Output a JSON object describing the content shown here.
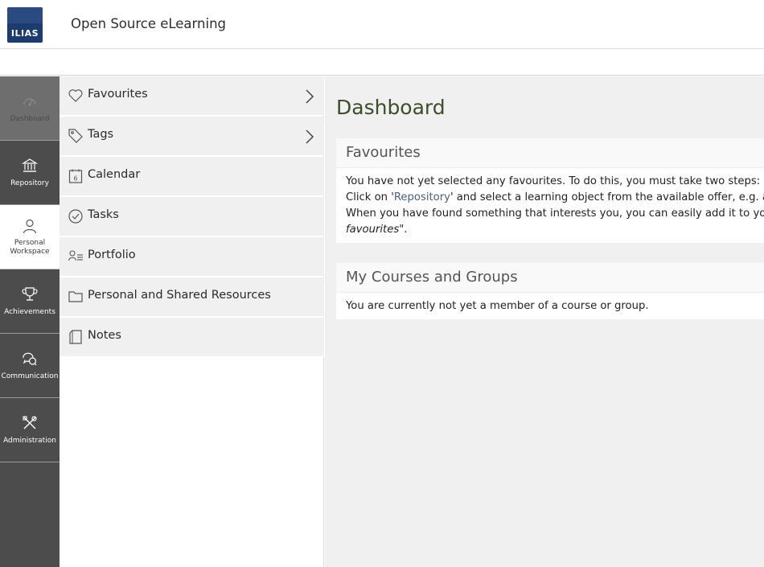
{
  "header": {
    "logo_text": "ILIAS",
    "site_title": "Open Source eLearning"
  },
  "mainbar": {
    "items": [
      {
        "label": "Dashboard",
        "icon": "dashboard-icon"
      },
      {
        "label": "Repository",
        "icon": "repository-icon"
      },
      {
        "label": "Personal Workspace",
        "icon": "person-icon"
      },
      {
        "label": "Achievements",
        "icon": "trophy-icon"
      },
      {
        "label": "Communication",
        "icon": "chat-icon"
      },
      {
        "label": "Administration",
        "icon": "tools-icon"
      }
    ],
    "workspace_label_line1": "Personal",
    "workspace_label_line2": "Workspace"
  },
  "slate": {
    "items": [
      {
        "label": "Favourites",
        "icon": "heart-icon",
        "has_submenu": true
      },
      {
        "label": "Tags",
        "icon": "tag-icon",
        "has_submenu": true
      },
      {
        "label": "Calendar",
        "icon": "calendar-icon",
        "has_submenu": false,
        "calendar_day": "6"
      },
      {
        "label": "Tasks",
        "icon": "check-circle-icon",
        "has_submenu": false
      },
      {
        "label": "Portfolio",
        "icon": "portfolio-icon",
        "has_submenu": false
      },
      {
        "label": "Personal and Shared Resources",
        "icon": "folder-icon",
        "has_submenu": false
      },
      {
        "label": "Notes",
        "icon": "notes-icon",
        "has_submenu": false
      }
    ]
  },
  "content": {
    "page_title": "Dashboard",
    "favourites_panel": {
      "title": "Favourites",
      "line1": "You have not yet selected any favourites. To do this, you must take two steps:",
      "line2_prefix": "Click on '",
      "line2_link": "Repository",
      "line2_suffix": "' and select a learning object from the available offer, e.g. a le",
      "line3": "When you have found something that interests you, you can easily add it to your",
      "line4_italic": "favourites",
      "line4_suffix": "\"."
    },
    "courses_panel": {
      "title": "My Courses and Groups",
      "text": "You are currently not yet a member of a course or group."
    }
  },
  "colors": {
    "mainbar_bg": "#4c4c4c",
    "logo_bg": "#1c3b6e",
    "page_title": "#3d4e2c",
    "content_bg": "#f0f0f0"
  }
}
